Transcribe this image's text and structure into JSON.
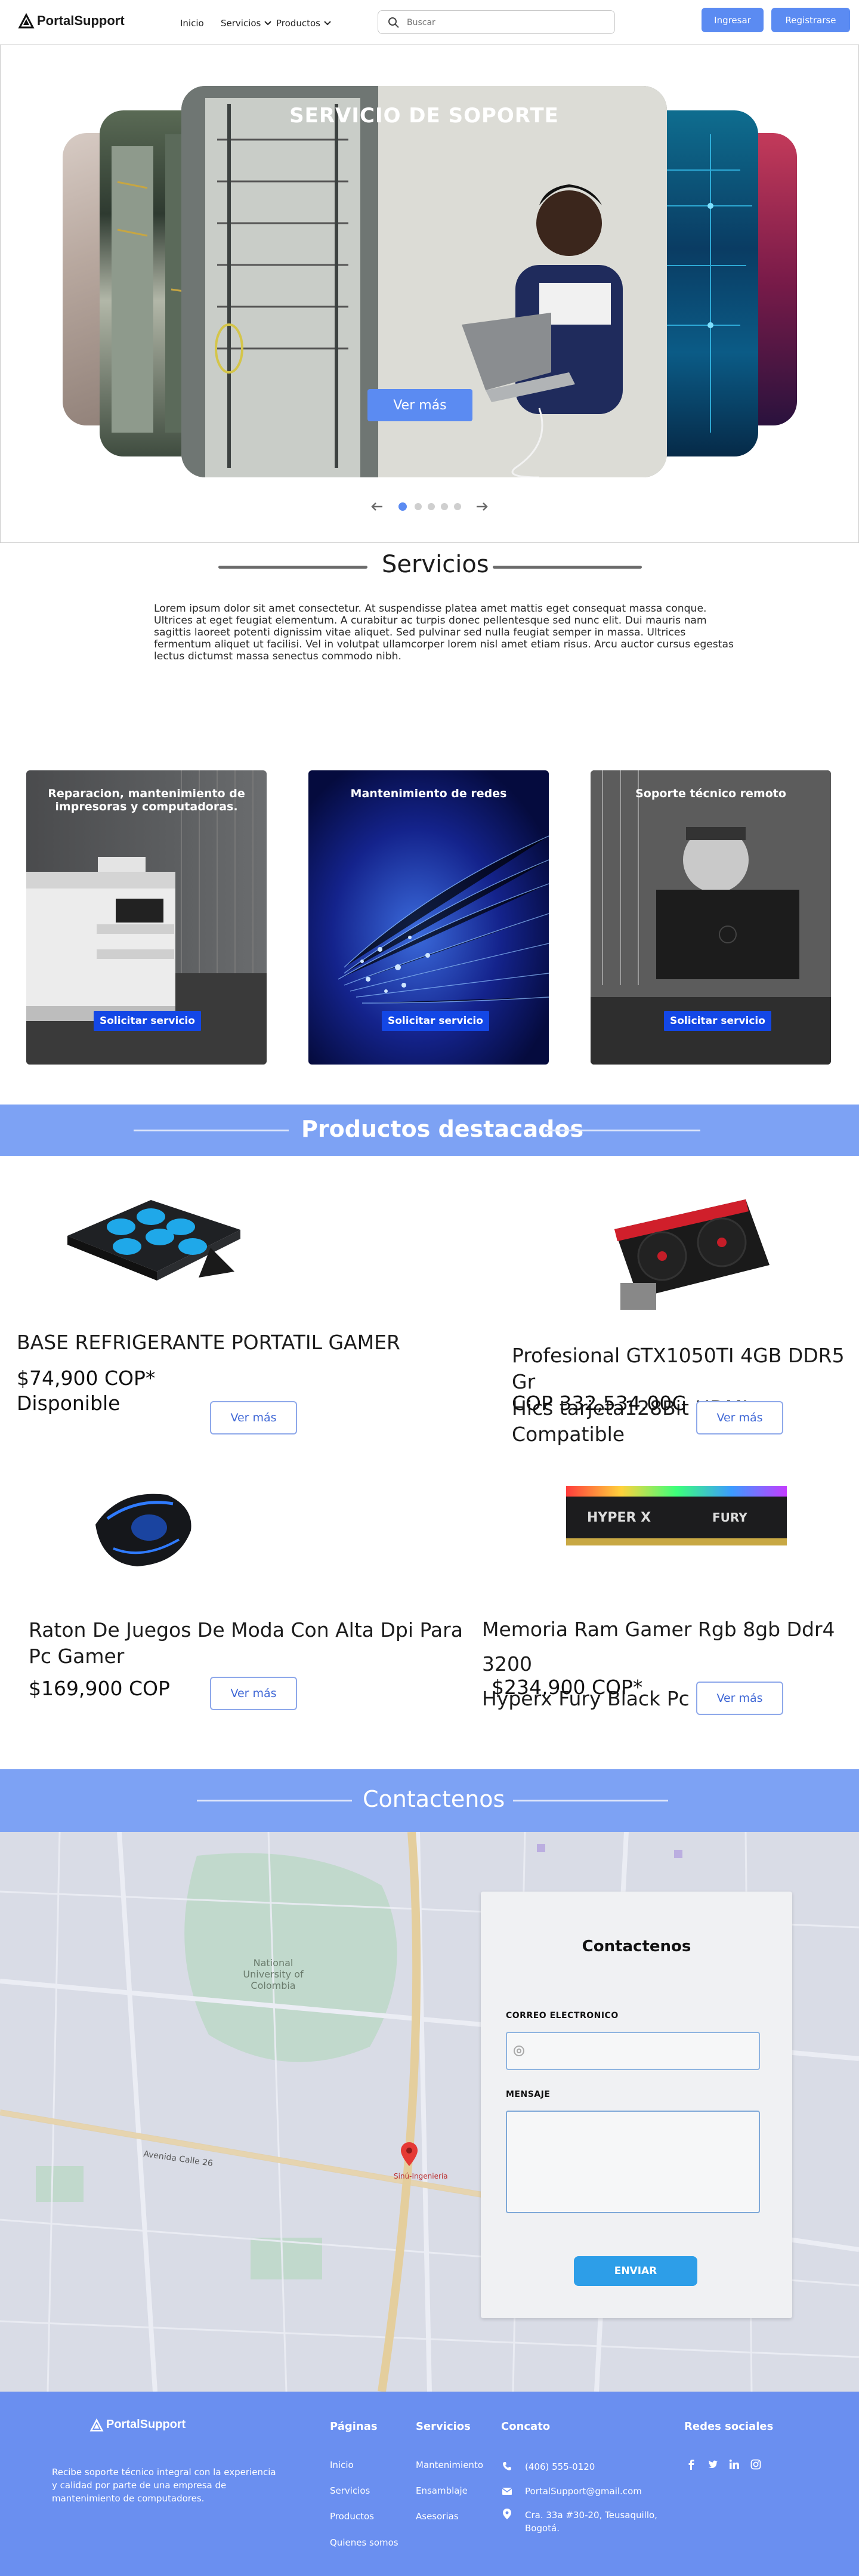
{
  "header": {
    "logo": "PortalSupport",
    "nav": {
      "inicio": "Inicio",
      "servicios": "Servicios",
      "productos": "Productos"
    },
    "search_placeholder": "Buscar",
    "login": "Ingresar",
    "register": "Registrarse"
  },
  "hero": {
    "title": "SERVICIO DE SOPORTE",
    "cta": "Ver más",
    "slides_total": 5,
    "active_slide": 1
  },
  "servicios": {
    "title": "Servicios",
    "intro": "Lorem ipsum dolor sit amet consectetur. At suspendisse platea amet mattis eget consequat massa conque. Ultrices at eget feugiat elementum. A curabitur ac turpis donec pellentesque sed nunc elit. Dui mauris nam sagittis laoreet potenti dignissim vitae aliquet. Sed pulvinar sed nulla feugiat semper in massa. Ultrices fermentum aliquet ut facilisi. Vel in volutpat ullamcorper lorem nisl amet etiam risus. Arcu auctor cursus egestas lectus dictumst massa senectus commodo nibh.",
    "cards": [
      {
        "title_1": "Reparacion, mantenimiento de",
        "title_2": "impresoras y computadoras.",
        "button": "Solicitar servicio"
      },
      {
        "title_1": "Mantenimiento de redes",
        "button": "Solicitar servicio"
      },
      {
        "title_1": "Soporte técnico remoto",
        "button": "Solicitar servicio"
      }
    ]
  },
  "productos": {
    "title": "Productos destacados",
    "items": [
      {
        "name_1": "BASE REFRIGERANTE PORTATIL GAMER",
        "price": "$74,900 COP*",
        "stock": "Disponible",
        "button": "Ver más"
      },
      {
        "name_1": "Profesional GTX1050TI 4GB DDR5 Gr",
        "name_2": "Hics tarjeta128Bit HDMI Compatible",
        "price": "COP 332,534.00C",
        "button": "Ver más"
      },
      {
        "name_1": "Raton De Juegos De Moda Con Alta Dpi Para",
        "name_2": "Pc Gamer",
        "price": "$169,900 COP",
        "button": "Ver más"
      },
      {
        "name_1": "Memoria Ram Gamer Rgb 8gb Ddr4 3200",
        "name_2": "Hyperx Fury Black Pc",
        "price": "$234,900 COP*",
        "button": "Ver más"
      }
    ]
  },
  "contacto": {
    "band_title": "Contactenos",
    "form_title": "Contactenos",
    "email_label": "CORREO ELECTRONICO",
    "message_label": "MENSAJE",
    "submit": "ENVIAR",
    "map_labels": {
      "university": "National University of Colombia",
      "street": "Avenida Calle 26",
      "place": "Sinú-Ingeniería"
    }
  },
  "footer": {
    "logo": "PortalSupport",
    "description_1": "Recibe soporte técnico integral con la experiencia",
    "description_2": "y calidad por parte de una empresa de",
    "description_3": "mantenimiento de computadores.",
    "paginas": {
      "title": "Páginas",
      "links": [
        "Inicio",
        "Servicios",
        "Productos",
        "Quienes somos"
      ]
    },
    "servicios": {
      "title": "Servicios",
      "links": [
        "Mantenimiento",
        "Ensamblaje",
        "Asesorias"
      ]
    },
    "contacto": {
      "title": "Concato",
      "phone": "(406) 555-0120",
      "email": "PortalSupport@gmail.com",
      "address_1": "Cra. 33a #30-20, Teusaquillo,",
      "address_2": "Bogotá."
    },
    "social": {
      "title": "Redes sociales",
      "icons": [
        "facebook-icon",
        "twitter-icon",
        "linkedin-icon",
        "instagram-icon"
      ]
    }
  },
  "colors": {
    "accent": "#5b8bf2",
    "band": "#7da2f4",
    "footer": "#6a8ff0",
    "service_button": "#1347e6"
  }
}
